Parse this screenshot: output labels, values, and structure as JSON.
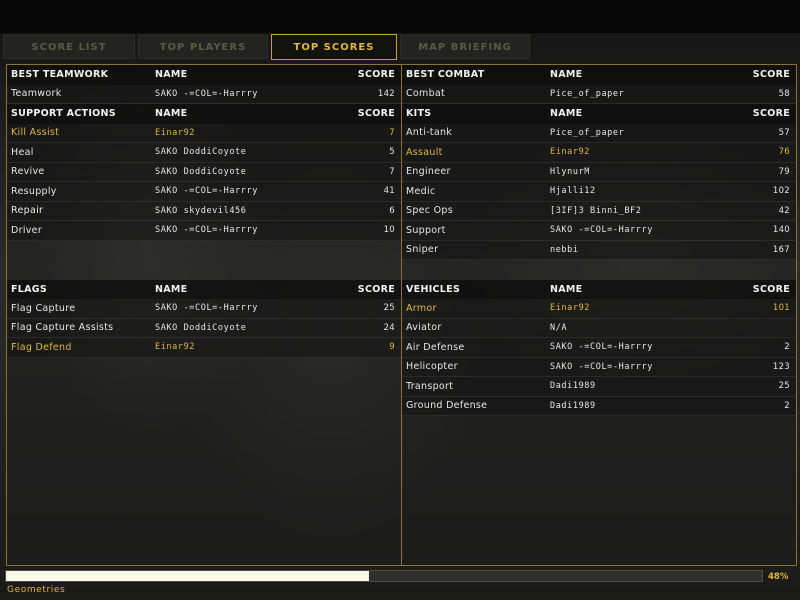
{
  "tabs": [
    {
      "label": "SCORE LIST",
      "active": false
    },
    {
      "label": "TOP PLAYERS",
      "active": false
    },
    {
      "label": "TOP SCORES",
      "active": true
    },
    {
      "label": "MAP BRIEFING",
      "active": false
    }
  ],
  "columns": {
    "name": "NAME",
    "score": "SCORE"
  },
  "left": {
    "sections": [
      {
        "title": "BEST TEAMWORK",
        "rows": [
          {
            "label": "Teamwork",
            "name": "SAKO -=COL=-Harrry",
            "score": "142",
            "highlight": false
          }
        ],
        "gap_after": 0
      },
      {
        "title": "SUPPORT ACTIONS",
        "rows": [
          {
            "label": "Kill Assist",
            "name": "Einar92",
            "score": "7",
            "highlight": true
          },
          {
            "label": "Heal",
            "name": "SAKO DoddiCoyote",
            "score": "5",
            "highlight": false
          },
          {
            "label": "Revive",
            "name": "SAKO DoddiCoyote",
            "score": "7",
            "highlight": false
          },
          {
            "label": "Resupply",
            "name": "SAKO -=COL=-Harrry",
            "score": "41",
            "highlight": false
          },
          {
            "label": "Repair",
            "name": "SAKO skydevil456",
            "score": "6",
            "highlight": false
          },
          {
            "label": "Driver",
            "name": "SAKO -=COL=-Harrry",
            "score": "10",
            "highlight": false
          }
        ],
        "gap_after": 2
      },
      {
        "title": "FLAGS",
        "rows": [
          {
            "label": "Flag Capture",
            "name": "SAKO -=COL=-Harrry",
            "score": "25",
            "highlight": false
          },
          {
            "label": "Flag Capture Assists",
            "name": "SAKO DoddiCoyote",
            "score": "24",
            "highlight": false
          },
          {
            "label": "Flag Defend",
            "name": "Einar92",
            "score": "9",
            "highlight": true
          }
        ],
        "gap_after": 0
      }
    ]
  },
  "right": {
    "sections": [
      {
        "title": "BEST COMBAT",
        "rows": [
          {
            "label": "Combat",
            "name": "Pice_of_paper",
            "score": "58",
            "highlight": false
          }
        ],
        "gap_after": 0
      },
      {
        "title": "KITS",
        "rows": [
          {
            "label": "Anti-tank",
            "name": "Pice_of_paper",
            "score": "57",
            "highlight": false
          },
          {
            "label": "Assault",
            "name": "Einar92",
            "score": "76",
            "highlight": true
          },
          {
            "label": "Engineer",
            "name": "HlynurM",
            "score": "79",
            "highlight": false
          },
          {
            "label": "Medic",
            "name": "Hjalli12",
            "score": "102",
            "highlight": false
          },
          {
            "label": "Spec Ops",
            "name": "[3IF]3 Binni_BF2",
            "score": "42",
            "highlight": false
          },
          {
            "label": "Support",
            "name": "SAKO -=COL=-Harrry",
            "score": "140",
            "highlight": false
          },
          {
            "label": "Sniper",
            "name": "nebbi",
            "score": "167",
            "highlight": false
          }
        ],
        "gap_after": 1
      },
      {
        "title": "VEHICLES",
        "rows": [
          {
            "label": "Armor",
            "name": "Einar92",
            "score": "101",
            "highlight": true
          },
          {
            "label": "Aviator",
            "name": "N/A",
            "score": "",
            "highlight": false
          },
          {
            "label": "Air Defense",
            "name": "SAKO -=COL=-Harrry",
            "score": "2",
            "highlight": false
          },
          {
            "label": "Helicopter",
            "name": "SAKO -=COL=-Harrry",
            "score": "123",
            "highlight": false
          },
          {
            "label": "Transport",
            "name": "Dadi1989",
            "score": "25",
            "highlight": false
          },
          {
            "label": "Ground Defense",
            "name": "Dadi1989",
            "score": "2",
            "highlight": false
          }
        ],
        "gap_after": 0
      }
    ]
  },
  "loading": {
    "progress": 0.48,
    "percent_label": "48%",
    "status_text": "Geometries"
  },
  "colors": {
    "accent": "#e0b83a",
    "border": "#8a7430",
    "progress_fill": "#fbf8e8"
  }
}
